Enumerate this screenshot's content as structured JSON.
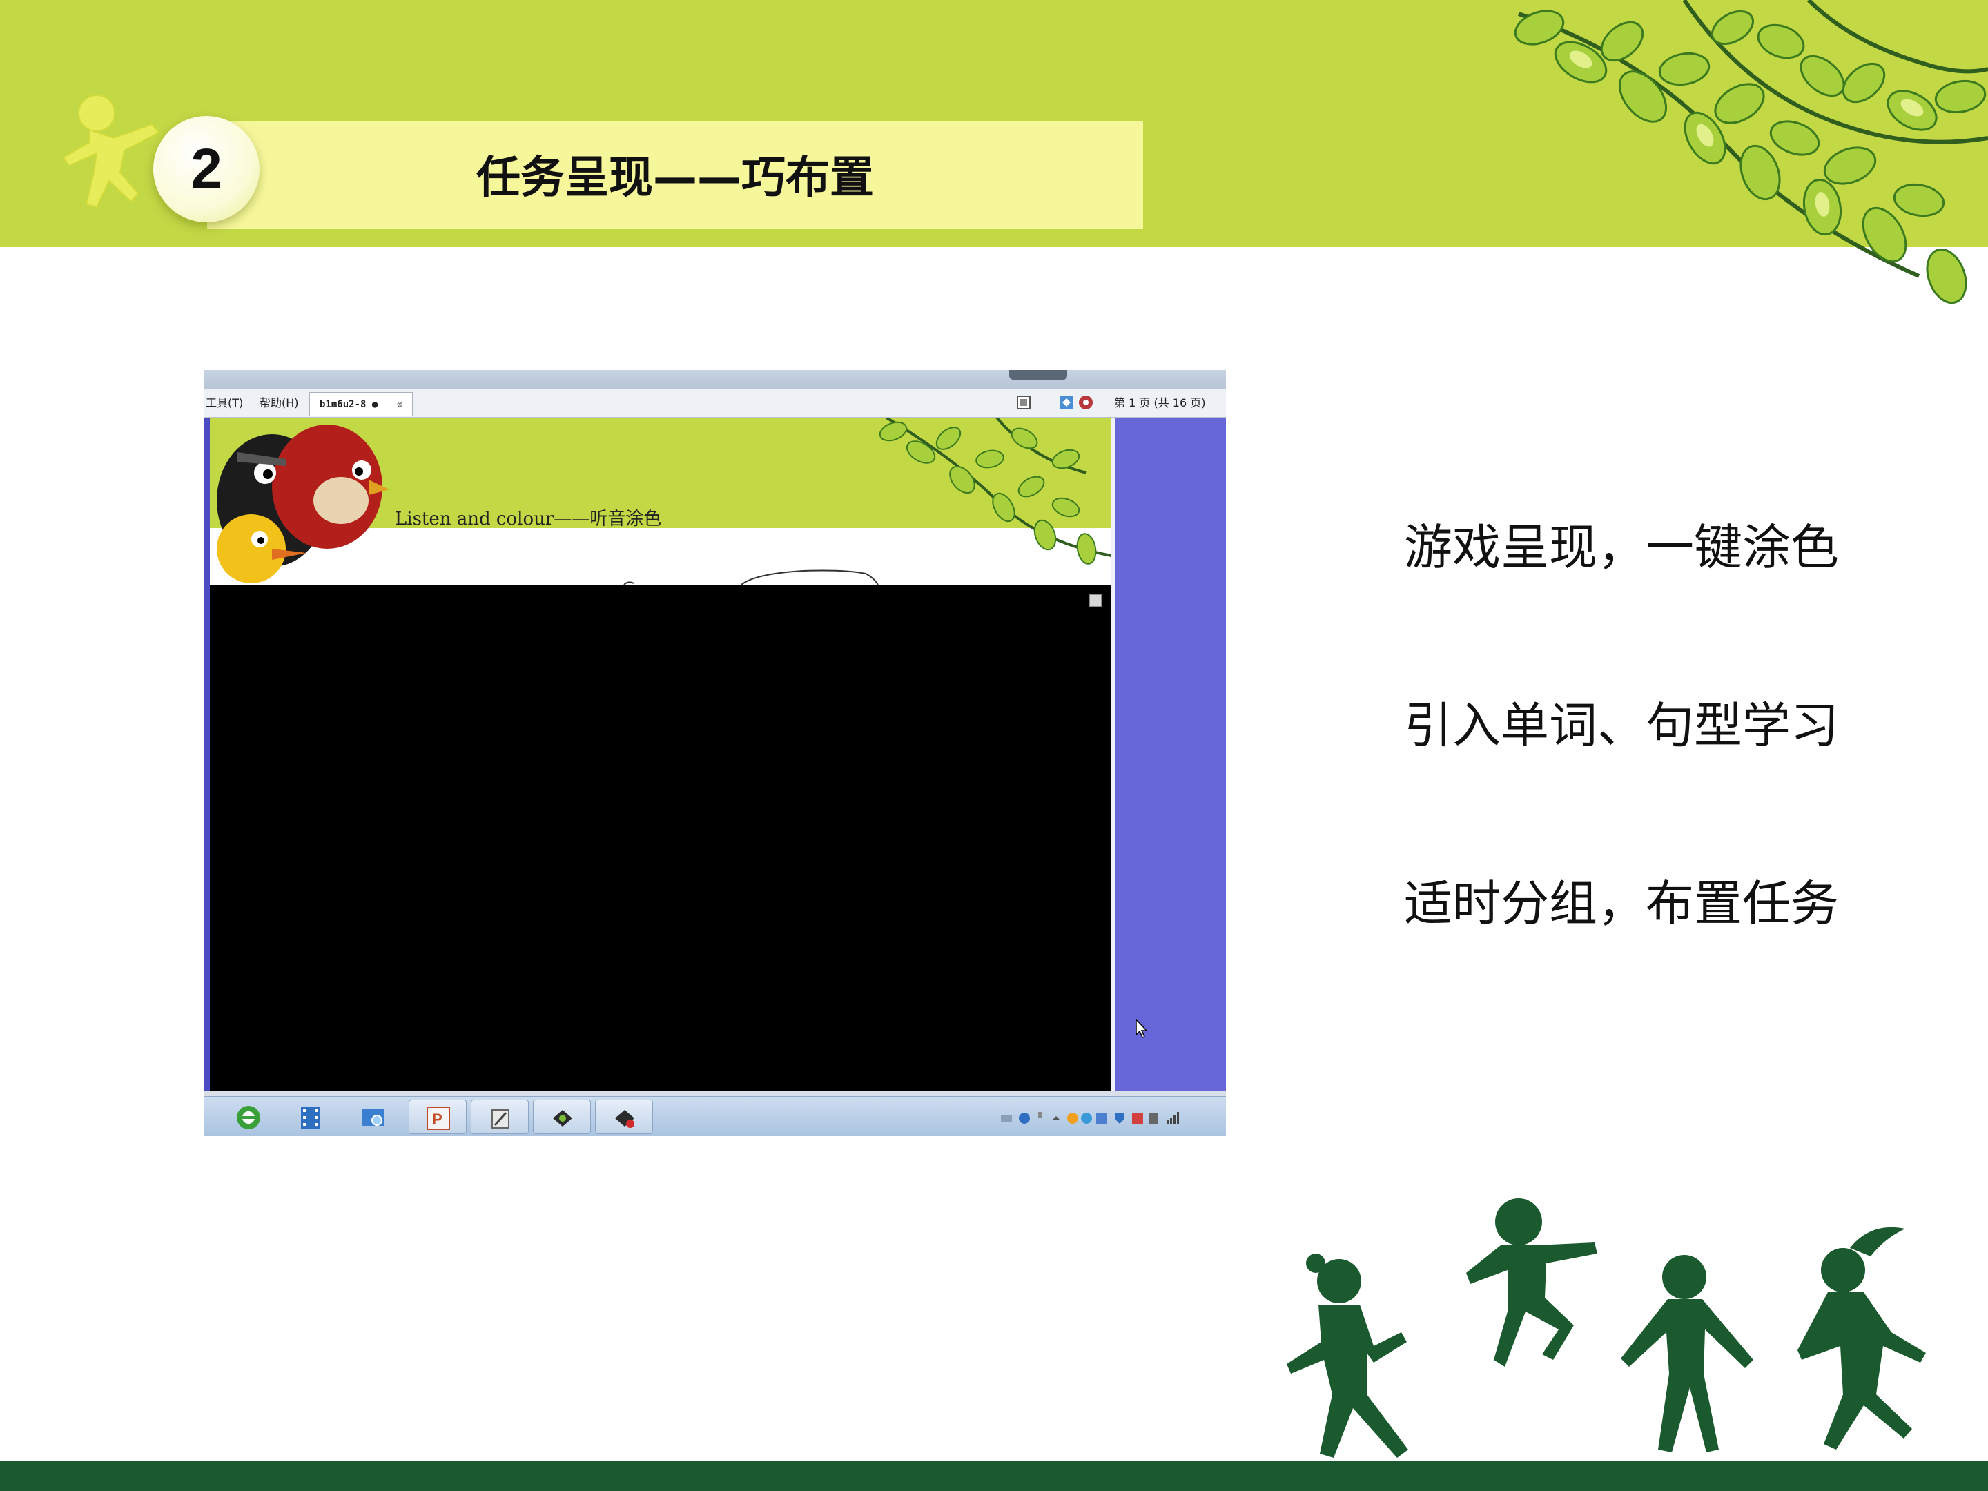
{
  "header": {
    "section_number": "2",
    "title": "任务呈现——巧布置"
  },
  "embedded_screenshot": {
    "menubar": {
      "menu_tools": "工具(T)",
      "menu_help": "帮助(H)",
      "doc_tab_label": "b1m6u2-8 ●",
      "doc_tab_close": "⊗",
      "page_indicator": "第 1 页 (共 16 页)"
    },
    "content": {
      "caption": "Listen and colour——听音涂色"
    },
    "taskbar": {
      "apps": [
        "browser-icon",
        "film-icon",
        "network-icon",
        "powerpoint-icon",
        "tool-icon",
        "app-icon",
        "app-icon-2"
      ]
    }
  },
  "bullets": [
    "游戏呈现，一键涂色",
    "引入单词、句型学习",
    "适时分组，布置任务"
  ],
  "colors": {
    "band": "#c2d845",
    "title_strip": "#f6f79a",
    "footer": "#1a5a2e",
    "silhouette": "#1a5a2e",
    "slide_area": "#6666d8"
  }
}
